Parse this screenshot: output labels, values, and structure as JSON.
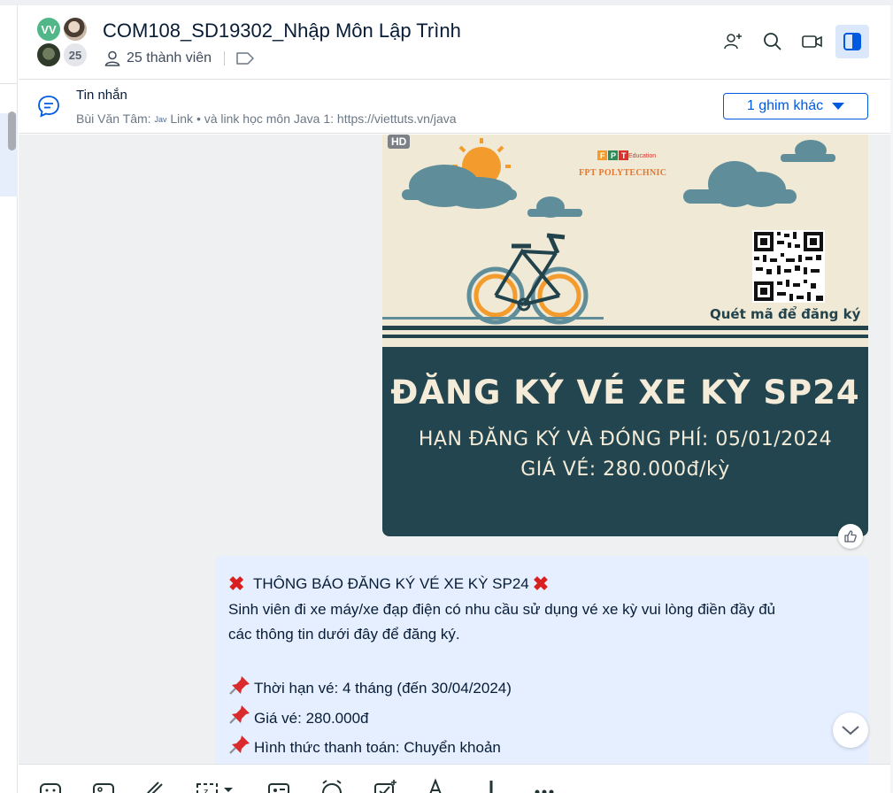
{
  "header": {
    "title": "COM108_SD19302_Nhập Môn Lập Trình",
    "members": "25 thành viên",
    "avatar_initials": "VV",
    "avatar_count": "25"
  },
  "pinned": {
    "title": "Tin nhắn",
    "sender": "Bùi Văn Tâm:",
    "link_icon_text": "Jav",
    "link_label": "Link",
    "text": "• và link học môn Java 1: https://viettuts.vn/java",
    "more_button": "1 ghim khác"
  },
  "image": {
    "badge": "HD",
    "brand": "FPT POLYTECHNIC",
    "brand_small": "Education",
    "scan_text": "Quét mã để đăng ký",
    "poster_title": "ĐĂNG KÝ VÉ XE KỲ SP24",
    "poster_line1": "HẠN ĐĂNG KÝ VÀ ĐÓNG PHÍ: 05/01/2024",
    "poster_line2": "GIÁ VÉ: 280.000đ/kỳ"
  },
  "message": {
    "heading": "THÔNG BÁO ĐĂNG KÝ VÉ XE KỲ SP24",
    "line1": "Sinh viên đi xe máy/xe đạp điện có nhu cầu sử dụng vé xe kỳ vui lòng điền đầy đủ",
    "line2": "các thông tin dưới đây để đăng ký.",
    "bullets": [
      "Thời hạn vé: 4 tháng (đến 30/04/2024)",
      "Giá vé: 280.000đ",
      "Hình thức thanh toán: Chuyển khoản"
    ]
  },
  "colors": {
    "accent": "#005ae0",
    "message_bg": "#e5efff",
    "poster_dark": "#22454f",
    "poster_light": "#efe9d6"
  }
}
